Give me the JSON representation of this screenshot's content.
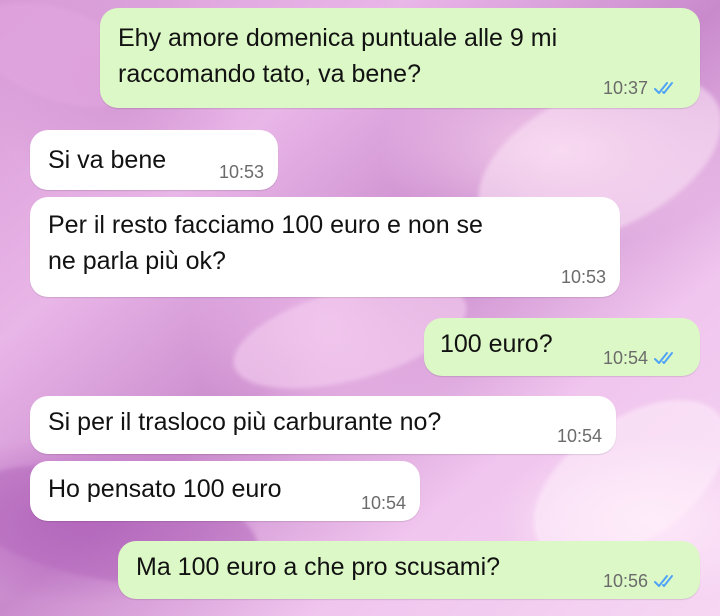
{
  "chat": {
    "messages": [
      {
        "direction": "out",
        "text": "Ehy amore domenica puntuale alle 9 mi\nraccomando tato, va bene?",
        "time": "10:37",
        "status_icon": "double-check-icon"
      },
      {
        "direction": "in",
        "text": "Si va bene",
        "time": "10:53"
      },
      {
        "direction": "in",
        "text": "Per il resto facciamo 100 euro e non se\nne parla più ok?",
        "time": "10:53"
      },
      {
        "direction": "out",
        "text": "100 euro?",
        "time": "10:54",
        "status_icon": "double-check-icon"
      },
      {
        "direction": "in",
        "text": "Si per il trasloco più carburante no?",
        "time": "10:54"
      },
      {
        "direction": "in",
        "text": "Ho pensato 100 euro",
        "time": "10:54"
      },
      {
        "direction": "out",
        "text": "Ma 100 euro a che pro scusami?",
        "time": "10:56",
        "status_icon": "double-check-icon"
      }
    ]
  },
  "colors": {
    "outgoing_bubble": "#dcf8c6",
    "incoming_bubble": "#ffffff",
    "read_ticks": "#4fa3f7"
  }
}
